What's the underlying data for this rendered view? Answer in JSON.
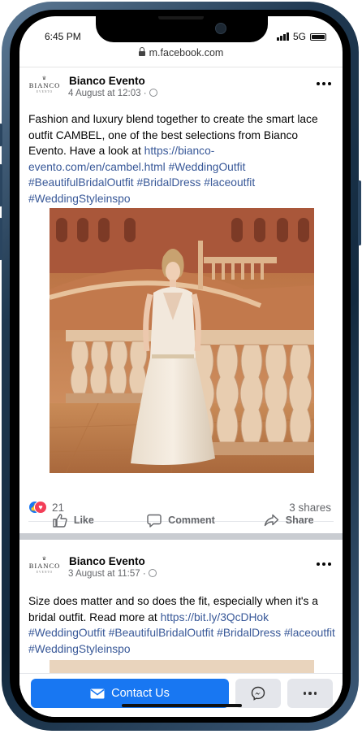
{
  "status": {
    "time": "6:45 PM",
    "network": "5G"
  },
  "browser": {
    "url": "m.facebook.com"
  },
  "colors": {
    "brand_blue": "#1877f2",
    "link": "#385898",
    "love_red": "#f33e58"
  },
  "posts": [
    {
      "page_name": "Bianco Evento",
      "logo_text": "BIANCO",
      "logo_sub": "EVENTO",
      "timestamp": "4 August at 12:03 ·",
      "text_intro": "Fashion and luxury blend together to create the smart lace outfit CAMBEL, one of the best selections from Bianco Evento. Have a look at",
      "link": "https://bianco-evento.com/en/cambel.html",
      "hashtags": [
        "#WeddingOutfit",
        "#BeautifulBridalOutfit",
        "#BridalDress",
        "#laceoutfit",
        "#WeddingStyleinspo"
      ],
      "reaction_count": "21",
      "shares": "3 shares",
      "actions": {
        "like": "Like",
        "comment": "Comment",
        "share": "Share"
      }
    },
    {
      "page_name": "Bianco Evento",
      "logo_text": "BIANCO",
      "logo_sub": "EVENTO",
      "timestamp": "3 August at 11:57 ·",
      "text_intro": "Size does matter and so does the fit, especially when it's a bridal outfit. Read more at",
      "link": "https://bit.ly/3QcDHok",
      "hashtags": [
        "#WeddingOutfit",
        "#BeautifulBridalOutfit",
        "#BridalDress",
        "#laceoutfit",
        "#WeddingStyleinspo"
      ]
    }
  ],
  "bottom_bar": {
    "contact_label": "Contact Us"
  }
}
